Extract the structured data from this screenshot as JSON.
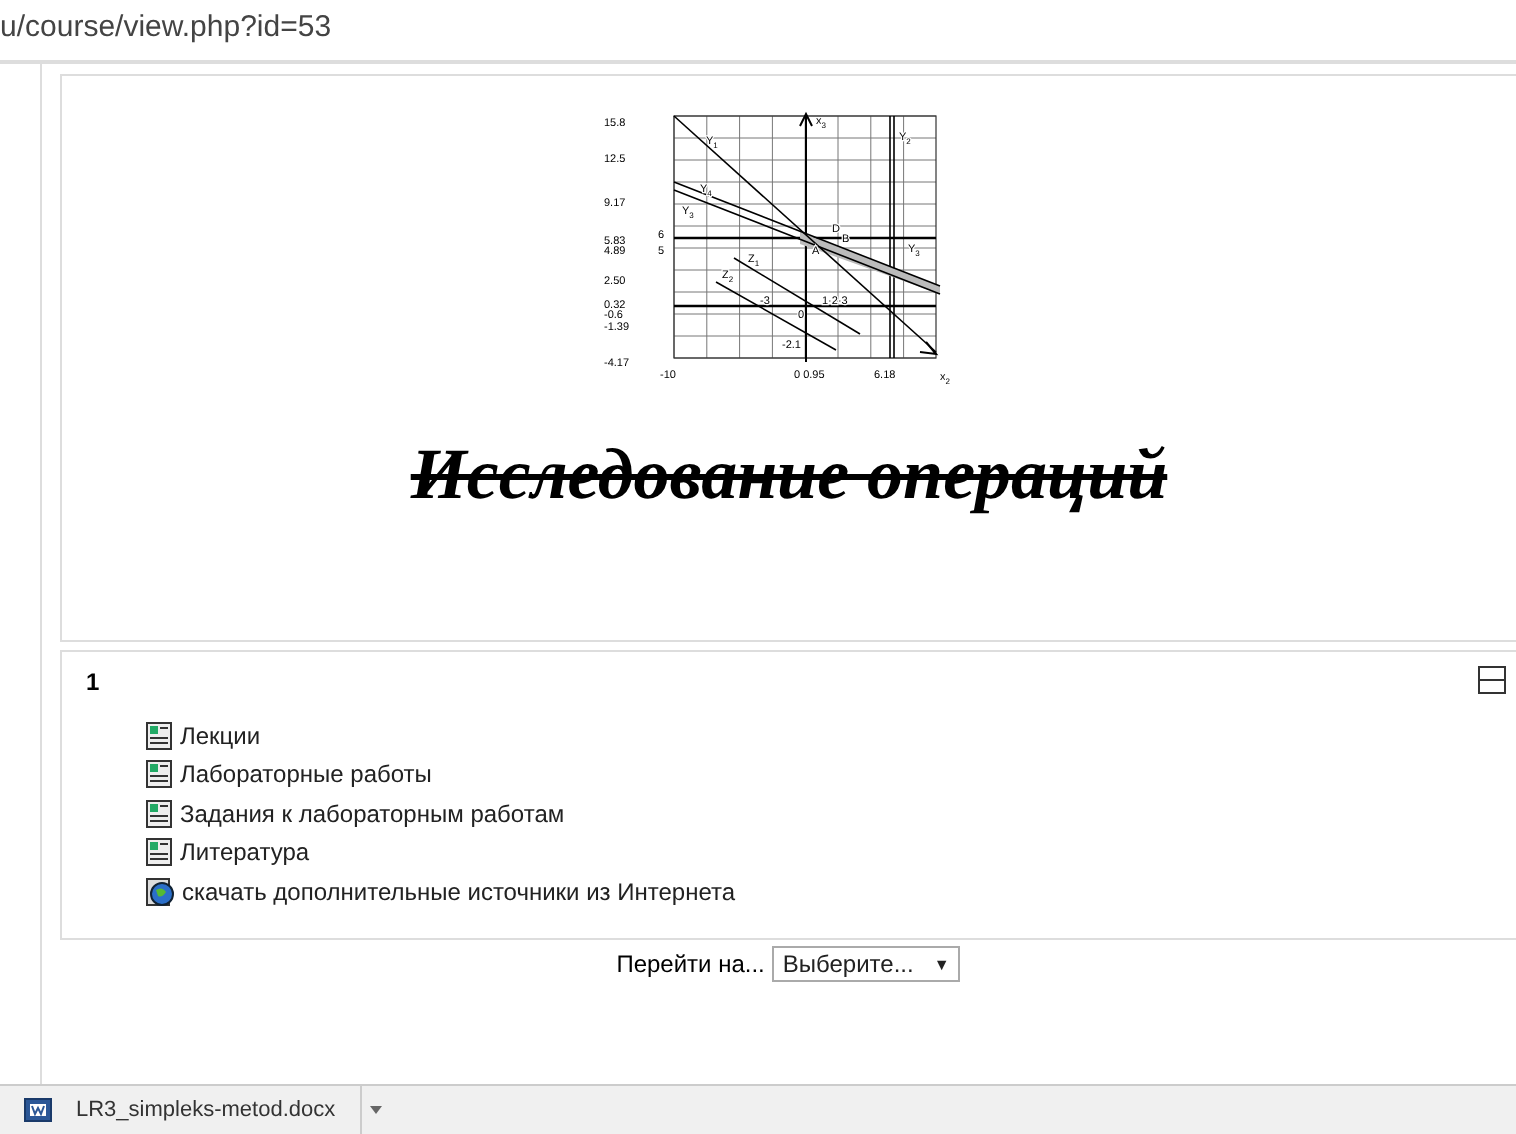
{
  "address_bar": {
    "url": "u/course/view.php?id=53"
  },
  "course_header": {
    "graph": {
      "y_labels": [
        "15.8",
        "12.5",
        "9.17",
        "5.83",
        "6",
        "4.89",
        "5",
        "2.50",
        "0.32",
        "-0.6",
        "-1.39",
        "-4.17"
      ],
      "x_labels": [
        "-10",
        "0 0.95",
        "6.18",
        "x$_{2}$"
      ],
      "curve_labels": [
        "x$_{3}$",
        "Y$_{2}$",
        "Y$_{1}$",
        "Y$_{4}$",
        "Y$_{3}$",
        "D",
        "A",
        "B",
        "Y$_{3}$",
        "Z$_{1}$",
        "Z$_{2}$",
        "-3",
        "1·2·3",
        "0",
        "-2.1"
      ]
    },
    "title": "Исследование операций"
  },
  "section": {
    "number": "1",
    "items": [
      {
        "kind": "file",
        "label": "Лекции"
      },
      {
        "kind": "file",
        "label": "Лабораторные работы"
      },
      {
        "kind": "file",
        "label": "Задания к лабораторным работам"
      },
      {
        "kind": "file",
        "label": "Литература"
      },
      {
        "kind": "url",
        "label": "скачать дополнительные источники из Интернета"
      }
    ]
  },
  "jump": {
    "label": "Перейти на...",
    "value": "Выберите...",
    "arrow": "▼"
  },
  "download_bar": {
    "file": "LR3_simpleks-metod.docx"
  }
}
